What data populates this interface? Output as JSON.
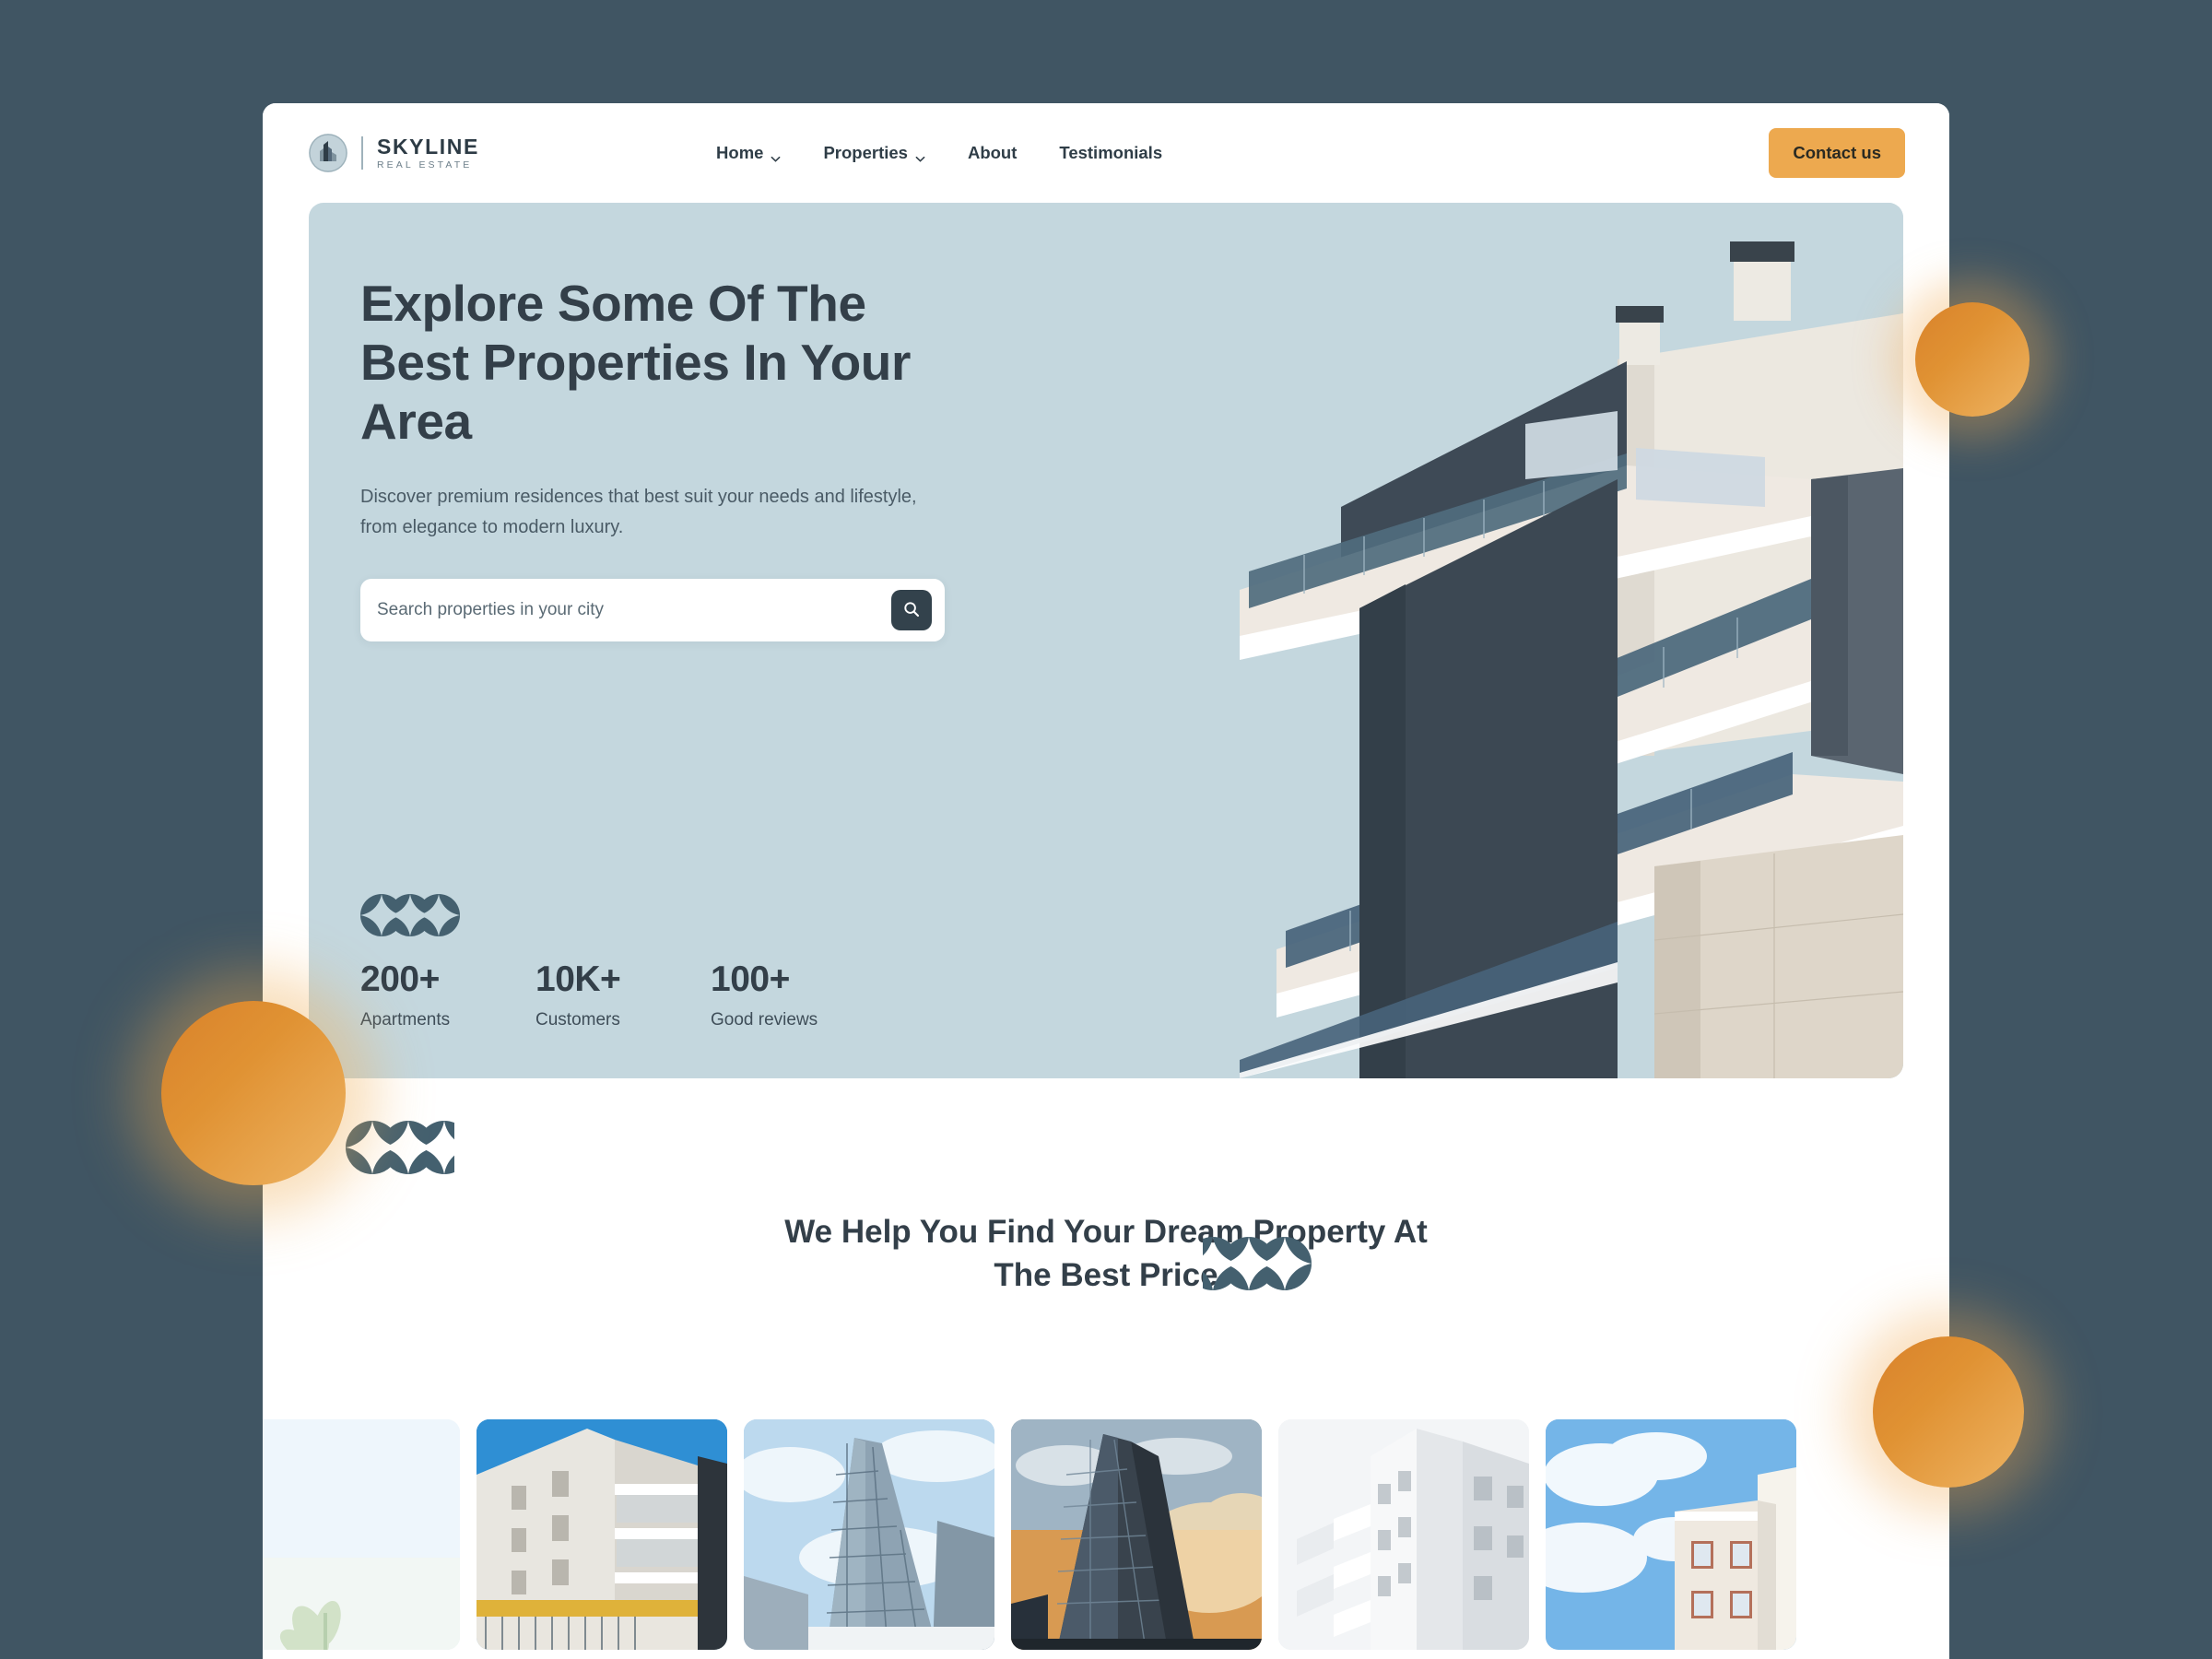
{
  "theme": {
    "page_bg": "#405563",
    "card_bg": "#ffffff",
    "hero_bg": "#c4d7de",
    "accent_orange": "#eda94f",
    "text_dark": "#333f49",
    "text_muted": "#4a5b66",
    "search_btn_bg": "#33424c",
    "motif_color": "#44606f"
  },
  "navbar": {
    "brand": {
      "name": "SKYLINE",
      "subtitle": "REAL ESTATE",
      "logo_icon": "building-circle-icon"
    },
    "links": [
      {
        "label": "Home",
        "has_dropdown": true,
        "icon": "chevron-down-icon"
      },
      {
        "label": "Properties",
        "has_dropdown": true,
        "icon": "chevron-down-icon"
      },
      {
        "label": "About",
        "has_dropdown": false
      },
      {
        "label": "Testimonials",
        "has_dropdown": false
      }
    ],
    "cta": {
      "label": "Contact us"
    }
  },
  "hero": {
    "title": "Explore Some Of The Best Properties In Your Area",
    "subtitle": "Discover premium residences that best suit your needs and lifestyle, from elegance to modern luxury.",
    "search": {
      "value": "",
      "placeholder": "Search properties in your city",
      "button_icon": "search-icon"
    },
    "motif_icon": "star-circles-motif",
    "stats": [
      {
        "value": "200+",
        "label": "Apartments"
      },
      {
        "value": "10K+",
        "label": "Customers"
      },
      {
        "value": "100+",
        "label": "Good reviews"
      }
    ],
    "photo_alt": "modern-apartment-building-balconies"
  },
  "section2": {
    "title": "We Help You Find Your Dream Property At The Best Price",
    "motif_left_icon": "star-circles-motif",
    "motif_right_icon": "star-circles-motif"
  },
  "gallery": {
    "items": [
      {
        "name": "property-thumb-1",
        "alt": "bright-sky-greenery",
        "style": "ph1"
      },
      {
        "name": "property-thumb-2",
        "alt": "white-apartment-block-balconies",
        "style": "ph2"
      },
      {
        "name": "property-thumb-3",
        "alt": "glass-office-tower-sky",
        "style": "ph3"
      },
      {
        "name": "property-thumb-4",
        "alt": "glass-skyscraper-sunset",
        "style": "ph4"
      },
      {
        "name": "property-thumb-5",
        "alt": "white-residential-building",
        "style": "ph5"
      },
      {
        "name": "property-thumb-6",
        "alt": "apartment-with-clouds",
        "style": "ph6"
      }
    ]
  },
  "decorations": {
    "circles": [
      {
        "name": "orange-circle-top-right",
        "color": "#e09233"
      },
      {
        "name": "orange-circle-left",
        "color": "#e09233"
      },
      {
        "name": "orange-circle-bottom-right",
        "color": "#e09233"
      }
    ]
  }
}
